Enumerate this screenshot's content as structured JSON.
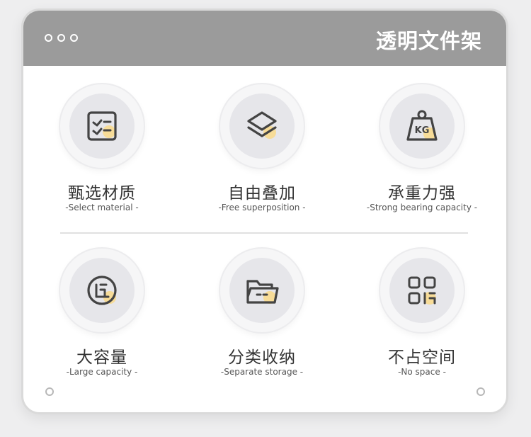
{
  "window": {
    "title": "透明文件架",
    "controls": [
      "dot-1",
      "dot-2",
      "dot-3"
    ]
  },
  "features": [
    {
      "title": "甄选材质",
      "subtitle": "-Select material -",
      "icon": "checklist-box-icon"
    },
    {
      "title": "自由叠加",
      "subtitle": "-Free superposition -",
      "icon": "stacked-layers-icon"
    },
    {
      "title": "承重力强",
      "subtitle": "-Strong bearing capacity -",
      "icon": "kg-weight-icon"
    },
    {
      "title": "大容量",
      "subtitle": "-Large capacity -",
      "icon": "capacity-circle-icon"
    },
    {
      "title": "分类收纳",
      "subtitle": "-Separate storage -",
      "icon": "folder-icon"
    },
    {
      "title": "不占空间",
      "subtitle": "-No space -",
      "icon": "grid-squares-icon"
    }
  ],
  "colors": {
    "titlebar": "#9b9b9b",
    "accent_highlight": "#f9d98a",
    "icon_stroke": "#444444",
    "text": "#333333"
  }
}
